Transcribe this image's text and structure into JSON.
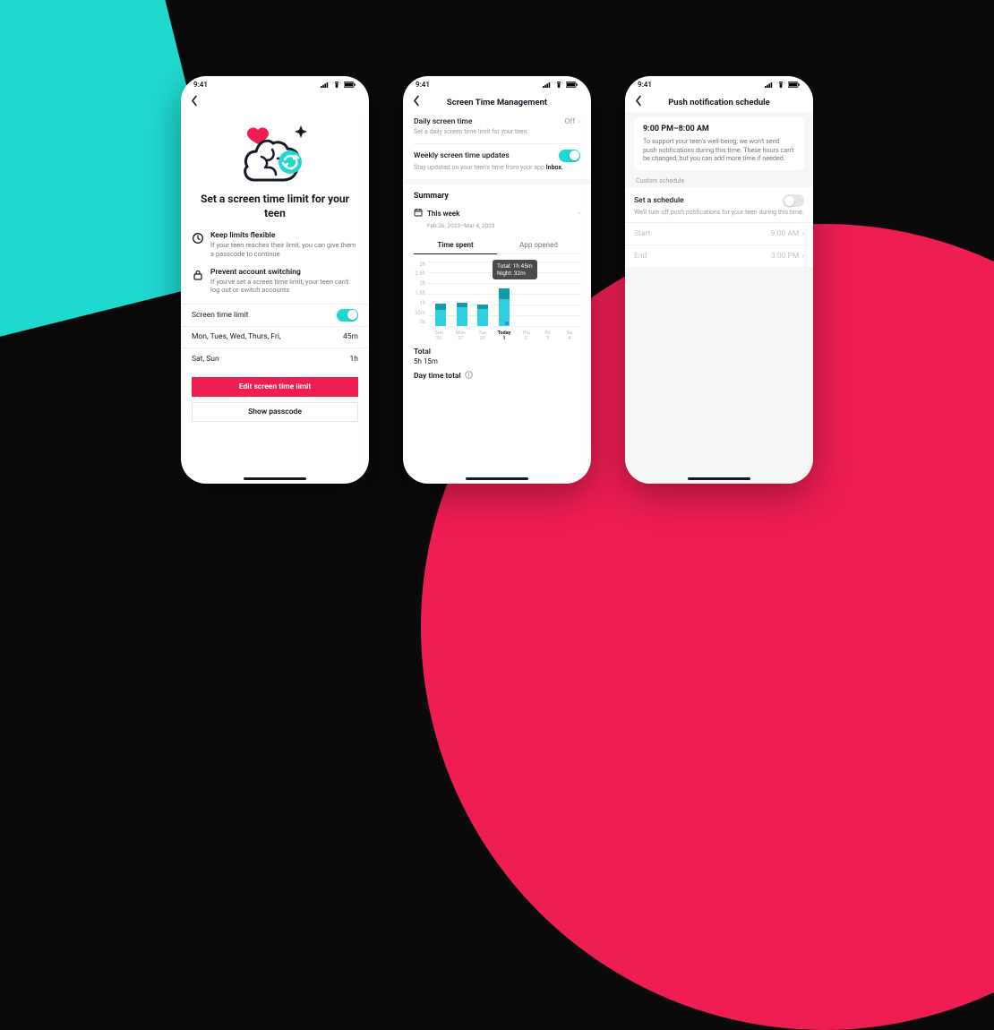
{
  "statusbar": {
    "time": "9:41"
  },
  "phone1": {
    "title": "Set a screen time limit for your teen",
    "bullets": [
      {
        "title": "Keep limits flexible",
        "text": "If your teen reaches their limit, you can give them a passcode to continue"
      },
      {
        "title": "Prevent account switching",
        "text": "If you've set a screen time limit, your teen can't log out or switch accounts"
      }
    ],
    "limit_row_label": "Screen time limit",
    "schedule": [
      {
        "days": "Mon, Tues, Wed, Thurs, Fri,",
        "value": "45m"
      },
      {
        "days": "Sat, Sun",
        "value": "1h"
      }
    ],
    "edit_button": "Edit screen time limit",
    "show_passcode": "Show passcode"
  },
  "phone2": {
    "nav_title": "Screen Time Management",
    "daily": {
      "title": "Daily screen time",
      "value": "Off",
      "sub": "Set a daily screen time limit for your teen."
    },
    "weekly": {
      "title": "Weekly screen time updates",
      "sub_prefix": "Stay updated on your teen's time from your app ",
      "sub_link": "Inbox."
    },
    "summary_label": "Summary",
    "week_selector": {
      "title": "This week",
      "range": "Feb 26, 2023–Mar 4, 2023"
    },
    "tabs": {
      "time_spent": "Time spent",
      "app_opened": "App opened"
    },
    "tooltip": {
      "line1": "Total: 1h 45m",
      "line2": "Night: 32m"
    },
    "totals": {
      "total_label": "Total",
      "total_value": "5h 15m",
      "day_label": "Day time total"
    }
  },
  "phone3": {
    "nav_title": "Push notification schedule",
    "range": "9:00 PM–8:00 AM",
    "desc": "To support your teen's well-being, we won't send push notifications during this time. These hours can't be changed, but you can add more time if needed.",
    "custom_label": "Custom schedule",
    "set_row": {
      "title": "Set a schedule",
      "sub": "We'll turn off push notifications for your teen during this time."
    },
    "start": {
      "label": "Start",
      "value": "9:00 AM"
    },
    "end": {
      "label": "End",
      "value": "3:00 PM"
    }
  },
  "chart_data": {
    "type": "bar",
    "categories": [
      "Sun 26",
      "Mon 27",
      "Tue 28",
      "Today 1",
      "Thu 2",
      "Fri 3",
      "Sa 4"
    ],
    "series": [
      {
        "name": "Day",
        "unit": "hours",
        "values": [
          0.75,
          0.85,
          0.78,
          1.22,
          0,
          0,
          0
        ]
      },
      {
        "name": "Night",
        "unit": "hours",
        "values": [
          0.28,
          0.22,
          0.2,
          0.53,
          0,
          0,
          0
        ]
      }
    ],
    "ylabel": "",
    "xlabel": "",
    "y_ticks": [
      "3h",
      "2.5h",
      "2h",
      "1.5h",
      "1h",
      "30m",
      "0s"
    ],
    "ylim_hours": [
      0,
      3
    ],
    "current_index": 3,
    "tooltip": {
      "total": "1h 45m",
      "night": "32m"
    }
  }
}
